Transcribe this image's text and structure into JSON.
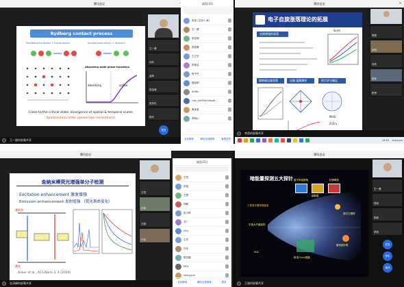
{
  "q1": {
    "window_title": "腾讯会议",
    "slide": {
      "title": "Rydberg contact process",
      "label_fac": "Facilitated excitation + transmission",
      "label_spont": "Spontaneous decay + recovery",
      "label_phase": "Absorbing state phase transition",
      "label_absorbing": "absorbing",
      "label_active": "active",
      "caption1": "Close to the critical state: divergence of spatial & temporal scales",
      "caption2": "Spontaneous order (power-law correlations)"
    },
    "video_tiles": [
      "",
      "王一健",
      "闫卉",
      "孟辉",
      "张洁涛",
      "张永先",
      "杨光",
      "李晨林"
    ],
    "mic_label": "发言",
    "recorder": "王一健的屏幕共享",
    "participants_header": "成员(41)",
    "participants": [
      "张浩 (主持人,我)",
      "王一健",
      "张佳琦",
      "张若琳",
      "王立华",
      "李清洁",
      "陈子丹",
      "侯晓明",
      "SHIRu",
      "rust_xjzf00d5dkaa8...",
      "黄泽宝",
      "李明川"
    ],
    "footer": [
      "全体静音",
      "解除全体静音",
      "管理成员"
    ]
  },
  "q2": {
    "window_title": "腾讯会议",
    "slide": {
      "title": "电子自旋涨落理论的拓展",
      "box1": "交换增强的涨落",
      "box2": "弱铁磁自旋涨落",
      "box3": "自旋-晶格耦合",
      "box4": "热力学与输运",
      "compound1": "Sc₃In",
      "compound2": "MnSi",
      "compound3": "ZrZn₂"
    },
    "video_tiles": [
      "",
      "李燕",
      "孙晓",
      "刘杰",
      "谢宝",
      "陈思"
    ],
    "recorder": "李燕的屏幕共享",
    "time": "15:10",
    "date": "2022/1/20",
    "taskbar_colors": [
      "#d23b3b",
      "#e8a100",
      "#2aa05b",
      "#3a6fd8",
      "#9b59b6",
      "#e67e22",
      "#1abc9c",
      "#e74c3c",
      "#34495e",
      "#f1c40f",
      "#2980b9",
      "#27ae60"
    ]
  },
  "q3": {
    "window_title": "腾讯会议",
    "slide": {
      "title": "金纳米棒荧光增强单分子检测",
      "bullet1": "Excitation enhancement 激发增强",
      "bullet2": "Emission enhancement 发射增强 （荧光寿命变化）",
      "l_exc": "激发态",
      "l_gs": "基态",
      "citation": "Anker et al., ACS Nano 3, 4 (2009)"
    },
    "video_tiles": [
      "",
      "王悦",
      "张蓓",
      "王丽",
      "许伟"
    ],
    "recorder": "金涛峰的屏幕共享",
    "participants_header": "成员(31)",
    "participants": [
      "王悦",
      "张蓓",
      "王丽",
      "林敏",
      "张小林",
      "刘一",
      "yihy",
      "王杰",
      "许伟",
      "周白鹤",
      "NEX",
      "zhangyue"
    ],
    "footer": [
      "全体静音",
      "解除全体静音",
      "更多"
    ]
  },
  "q4": {
    "window_title": "腾讯会议",
    "slide": {
      "title": "暗能量探测五大探针",
      "label1": "重子声波振荡",
      "label2": "超新星",
      "label3": "红移畸变",
      "label4": "弱引力透镜",
      "label5": "星系团计数",
      "label6": "射电21cm强度",
      "label7": "SKA",
      "label8": "宇宙大尺度结构",
      "left_note": "人类首次看到暗能量"
    },
    "video_tiles": [
      "",
      "王一健",
      "张晓",
      "陈新",
      "李锐"
    ],
    "mic_labels": [
      "发言",
      "举手",
      "离开"
    ],
    "recorder": "王骏的屏幕共享"
  }
}
